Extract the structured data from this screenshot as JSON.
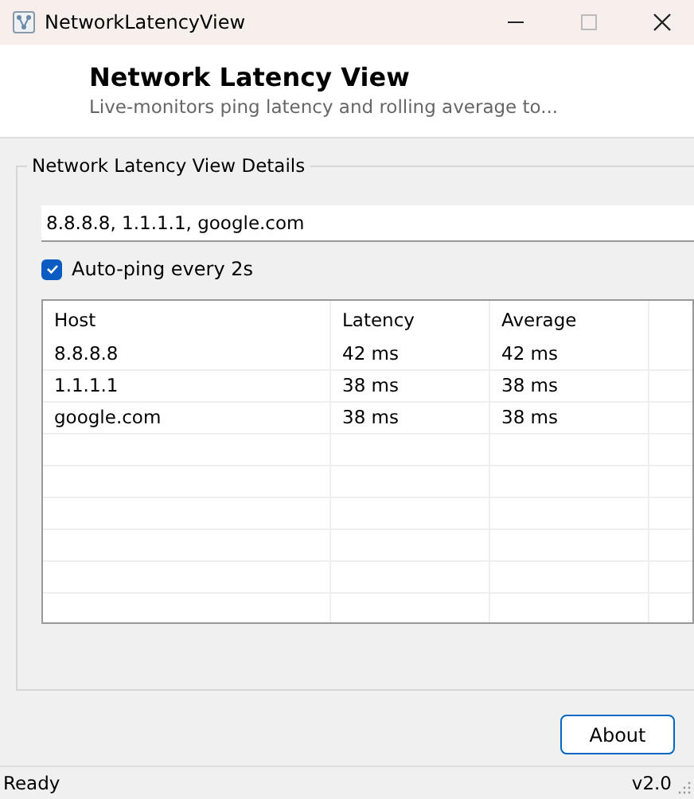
{
  "window": {
    "title": "NetworkLatencyView"
  },
  "header": {
    "title": "Network Latency View",
    "subtitle": "Live-monitors ping latency and rolling average to..."
  },
  "group": {
    "title": "Network Latency View Details"
  },
  "hosts_field": {
    "value": "8.8.8.8, 1.1.1.1, google.com"
  },
  "auto_ping": {
    "label": "Auto-ping every 2s",
    "checked": true
  },
  "table": {
    "columns": [
      "Host",
      "Latency",
      "Average"
    ],
    "rows": [
      {
        "cells": [
          "8.8.8.8",
          "42 ms",
          "42 ms"
        ]
      },
      {
        "cells": [
          "1.1.1.1",
          "38 ms",
          "38 ms"
        ]
      },
      {
        "cells": [
          "google.com",
          "38 ms",
          "38 ms"
        ]
      }
    ]
  },
  "buttons": [
    "About"
  ],
  "status_bar": {
    "left": "Ready",
    "right": "v2.0"
  }
}
